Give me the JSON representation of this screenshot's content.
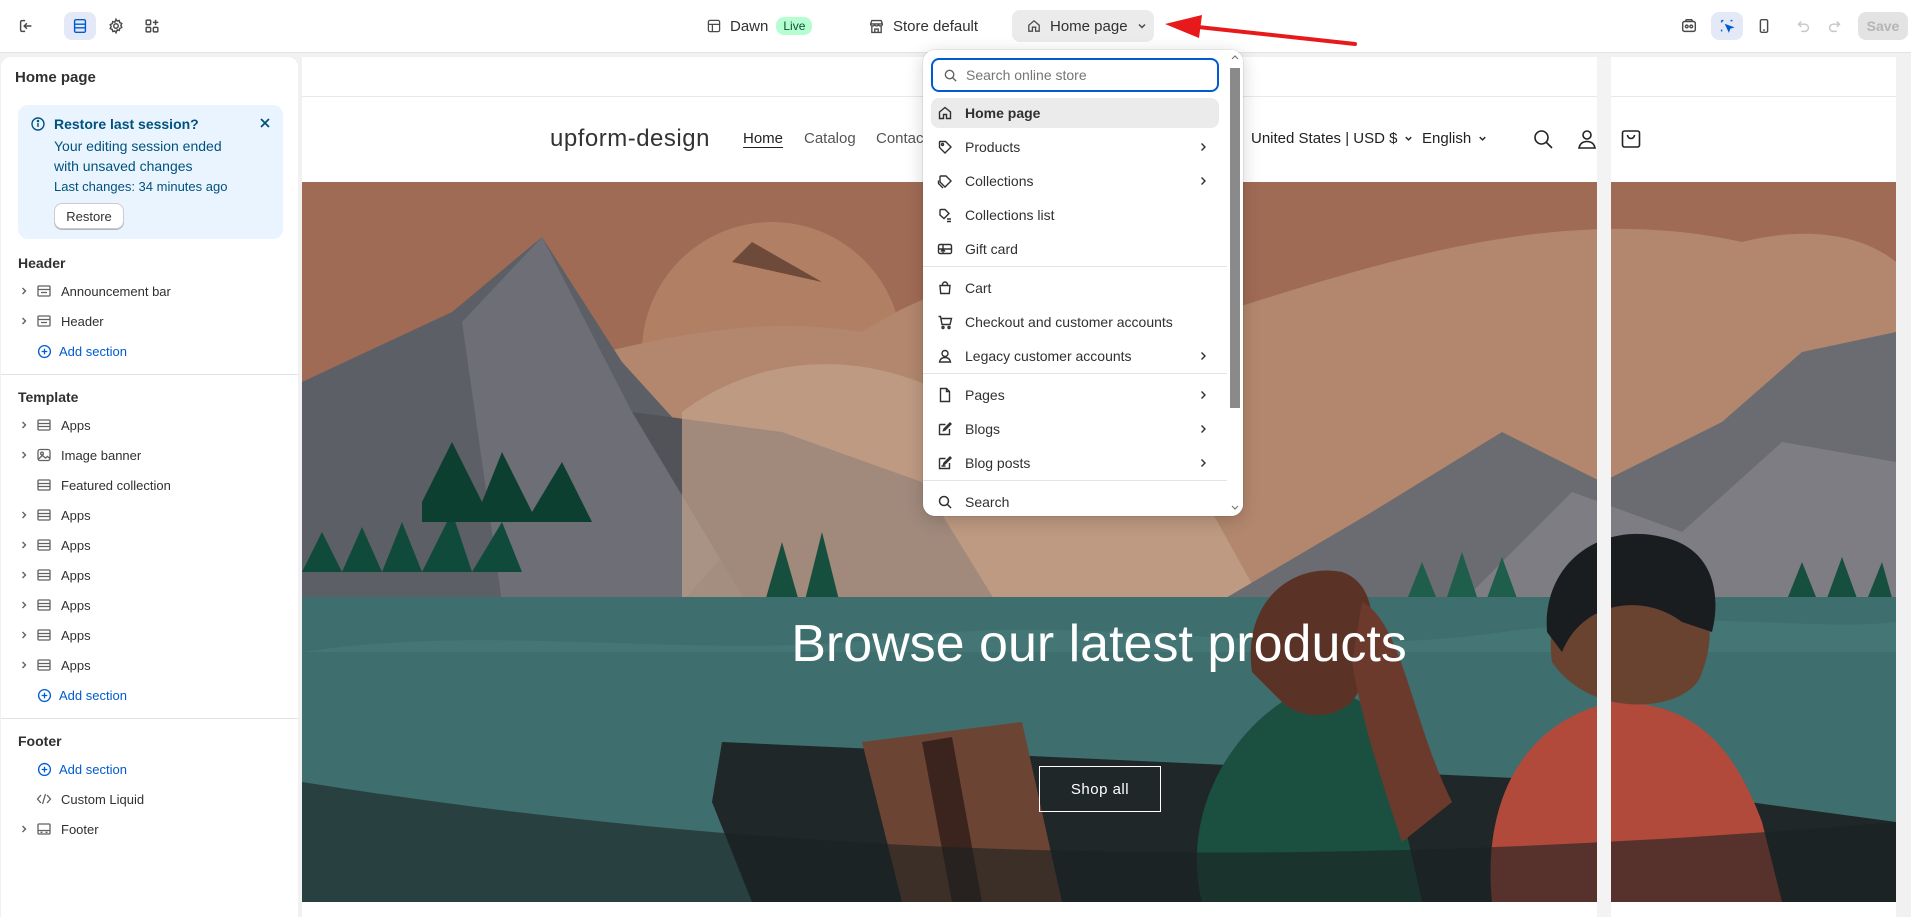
{
  "topbar": {
    "theme_name": "Dawn",
    "live_badge": "Live",
    "store_label": "Store default",
    "page_selector": "Home page",
    "save_label": "Save"
  },
  "sidebar": {
    "title": "Home page",
    "restore": {
      "title": "Restore last session?",
      "message": "Your editing session ended with unsaved changes",
      "last_changes": "Last changes: 34 minutes ago",
      "button": "Restore"
    },
    "groups": [
      {
        "title": "Header",
        "items": [
          "Announcement bar",
          "Header"
        ],
        "add": "Add section"
      },
      {
        "title": "Template",
        "items": [
          "Apps",
          "Image banner",
          "Featured collection",
          "Apps",
          "Apps",
          "Apps",
          "Apps",
          "Apps",
          "Apps"
        ],
        "add": "Add section"
      },
      {
        "title": "Footer",
        "add": "Add section",
        "items": [
          "Custom Liquid",
          "Footer"
        ]
      }
    ]
  },
  "preview": {
    "store_logo": "upform-design",
    "nav": [
      "Home",
      "Catalog",
      "Contact"
    ],
    "country": "United States | USD $",
    "language": "English",
    "hero_title": "Browse our latest products",
    "hero_button": "Shop all"
  },
  "dropdown": {
    "search_placeholder": "Search online store",
    "items": [
      {
        "label": "Home page",
        "icon": "home-icon",
        "submenu": false
      },
      {
        "label": "Products",
        "icon": "tag-icon",
        "submenu": true
      },
      {
        "label": "Collections",
        "icon": "collection-icon",
        "submenu": true
      },
      {
        "label": "Collections list",
        "icon": "collections-list-icon",
        "submenu": false
      },
      {
        "label": "Gift card",
        "icon": "gift-card-icon",
        "submenu": false
      },
      {
        "label": "Cart",
        "icon": "bag-icon",
        "submenu": false
      },
      {
        "label": "Checkout and customer accounts",
        "icon": "cart-icon",
        "submenu": false
      },
      {
        "label": "Legacy customer accounts",
        "icon": "person-icon",
        "submenu": true
      },
      {
        "label": "Pages",
        "icon": "page-icon",
        "submenu": true
      },
      {
        "label": "Blogs",
        "icon": "blog-icon",
        "submenu": true
      },
      {
        "label": "Blog posts",
        "icon": "blog-post-icon",
        "submenu": true
      },
      {
        "label": "Search",
        "icon": "search-icon",
        "submenu": false
      }
    ]
  },
  "colors": {
    "accent": "#005bd3",
    "banner_bg": "#eaf4ff",
    "live_bg": "#b4fed2",
    "arrow": "#e8191a"
  }
}
